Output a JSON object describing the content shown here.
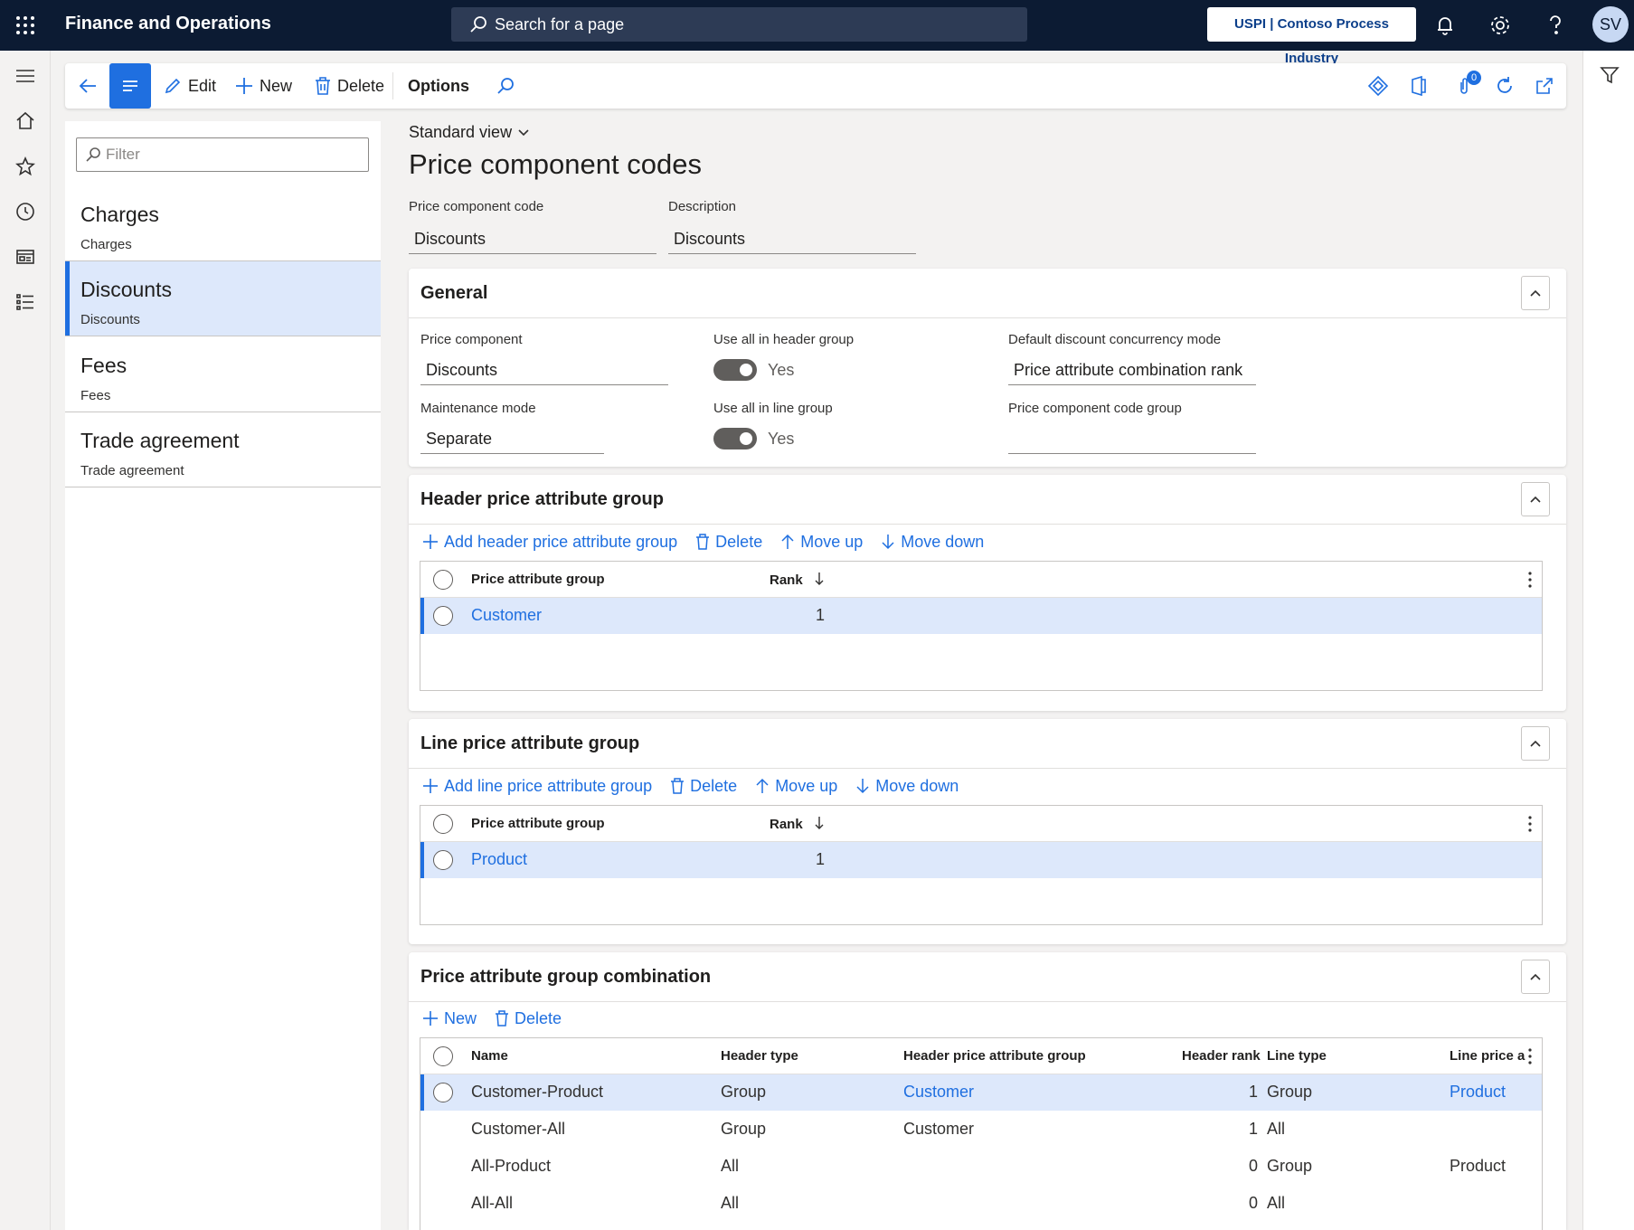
{
  "topbar": {
    "app_title": "Finance and Operations",
    "search_placeholder": "Search for a page",
    "company": "USPI | Contoso Process Industry",
    "avatar_initials": "SV"
  },
  "actionpane": {
    "edit": "Edit",
    "new": "New",
    "delete": "Delete",
    "options": "Options",
    "attachments_count": "0"
  },
  "list": {
    "filter_placeholder": "Filter",
    "items": [
      {
        "title": "Charges",
        "subtitle": "Charges"
      },
      {
        "title": "Discounts",
        "subtitle": "Discounts"
      },
      {
        "title": "Fees",
        "subtitle": "Fees"
      },
      {
        "title": "Trade agreement",
        "subtitle": "Trade agreement"
      }
    ]
  },
  "main": {
    "view": "Standard view",
    "title": "Price component codes",
    "header": {
      "code_label": "Price component code",
      "code_value": "Discounts",
      "desc_label": "Description",
      "desc_value": "Discounts"
    }
  },
  "general": {
    "title": "General",
    "price_component_label": "Price component",
    "price_component_value": "Discounts",
    "maintenance_mode_label": "Maintenance mode",
    "maintenance_mode_value": "Separate",
    "use_all_header_label": "Use all in header group",
    "use_all_header_value": "Yes",
    "use_all_line_label": "Use all in line group",
    "use_all_line_value": "Yes",
    "concurrency_label": "Default discount concurrency mode",
    "concurrency_value": "Price attribute combination rank",
    "code_group_label": "Price component code group",
    "code_group_value": ""
  },
  "header_group": {
    "title": "Header price attribute group",
    "toolbar": {
      "add": "Add header price attribute group",
      "delete": "Delete",
      "move_up": "Move up",
      "move_down": "Move down"
    },
    "columns": {
      "group": "Price attribute group",
      "rank": "Rank"
    },
    "rows": [
      {
        "group": "Customer",
        "rank": "1"
      }
    ]
  },
  "line_group": {
    "title": "Line price attribute group",
    "toolbar": {
      "add": "Add line price attribute group",
      "delete": "Delete",
      "move_up": "Move up",
      "move_down": "Move down"
    },
    "columns": {
      "group": "Price attribute group",
      "rank": "Rank"
    },
    "rows": [
      {
        "group": "Product",
        "rank": "1"
      }
    ]
  },
  "combination": {
    "title": "Price attribute group combination",
    "toolbar": {
      "new": "New",
      "delete": "Delete"
    },
    "columns": {
      "name": "Name",
      "header_type": "Header type",
      "header_group": "Header price attribute group",
      "header_rank": "Header rank",
      "line_type": "Line type",
      "line_group": "Line price a"
    },
    "rows": [
      {
        "name": "Customer-Product",
        "header_type": "Group",
        "header_group": "Customer",
        "header_rank": "1",
        "line_type": "Group",
        "line_group": "Product"
      },
      {
        "name": "Customer-All",
        "header_type": "Group",
        "header_group": "Customer",
        "header_rank": "1",
        "line_type": "All",
        "line_group": ""
      },
      {
        "name": "All-Product",
        "header_type": "All",
        "header_group": "",
        "header_rank": "0",
        "line_type": "Group",
        "line_group": "Product"
      },
      {
        "name": "All-All",
        "header_type": "All",
        "header_group": "",
        "header_rank": "0",
        "line_type": "All",
        "line_group": ""
      }
    ]
  },
  "colors": {
    "accent": "#1f6fe0",
    "topbar": "#0c1b33",
    "selected_row": "#dde8fb"
  }
}
